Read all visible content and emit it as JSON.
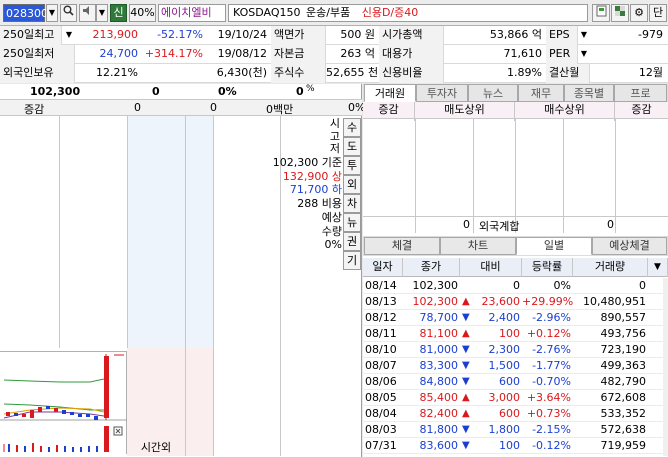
{
  "toolbar": {
    "code": "028300",
    "sin_label": "신",
    "pct_label": "40%",
    "stock_name": "에이치엘비",
    "market": "KOSDAQ150",
    "sector": "운송/부품",
    "credit": "신용D/증40"
  },
  "summary": {
    "rows": [
      {
        "l1": "250일최고",
        "v1": "213,900",
        "p1": "-52.17%",
        "d1": "19/10/24",
        "l2": "액면가",
        "v2": "500 원",
        "l3": "시가총액",
        "v3": "53,866 억",
        "l4": "EPS",
        "v4": "-979"
      },
      {
        "l1": "250일최저",
        "v1": "24,700",
        "p1": "+314.17%",
        "d1": "19/08/12",
        "l2": "자본금",
        "v2": "263 억",
        "l3": "대용가",
        "v3": "71,610",
        "l4": "PER",
        "v4": ""
      },
      {
        "l1": "외국인보유",
        "v1": "12.21%",
        "p1": "6,430(천)",
        "d1": "",
        "l2": "주식수",
        "v2": "52,655 천",
        "l3": "신용비율",
        "v3": "1.89%",
        "l4": "결산월",
        "v4": "12월"
      }
    ]
  },
  "left": {
    "price": "102,300",
    "change": "0",
    "pct": "0%",
    "vol": "0",
    "vol_unit": "%",
    "header_label": "증감",
    "header_vals": [
      "0",
      "0"
    ],
    "header_money": "0백만",
    "header_pct": "0%",
    "labels": [
      {
        "label": "시",
        "value": ""
      },
      {
        "label": "고",
        "value": ""
      },
      {
        "label": "저",
        "value": ""
      },
      {
        "label": "기준",
        "value": "102,300"
      },
      {
        "label": "상",
        "value": "132,900"
      },
      {
        "label": "하",
        "value": "71,700"
      },
      {
        "label": "비용",
        "value": "288"
      },
      {
        "label": "예상",
        "value": ""
      },
      {
        "label": "수량",
        "value": ""
      },
      {
        "label": "",
        "value": "0%"
      }
    ],
    "side_buttons": [
      "수",
      "도",
      "투",
      "외",
      "차",
      "뉴",
      "권",
      "기"
    ],
    "bottom_label": "시간외"
  },
  "right": {
    "tabs_top": [
      "거래원",
      "투자자",
      "뉴스",
      "재무",
      "종목별",
      "프로"
    ],
    "trader_headers": [
      "증감",
      "매도상위",
      "매수상위",
      "증감"
    ],
    "foreign_label": "외국계합",
    "foreign_vals": [
      "0",
      "0"
    ],
    "tabs_mid": [
      "체결",
      "차트",
      "일별",
      "예상체결"
    ],
    "table_headers": [
      "일자",
      "종가",
      "대비",
      "등락률",
      "거래량"
    ],
    "rows": [
      {
        "date": "08/14",
        "close": "102,300",
        "dir": "",
        "diff": "0",
        "rate": "0%",
        "vol": "0"
      },
      {
        "date": "08/13",
        "close": "102,300",
        "dir": "up",
        "diff": "23,600",
        "rate": "+29.99%",
        "vol": "10,480,951"
      },
      {
        "date": "08/12",
        "close": "78,700",
        "dir": "dn",
        "diff": "2,400",
        "rate": "-2.96%",
        "vol": "890,557"
      },
      {
        "date": "08/11",
        "close": "81,100",
        "dir": "up",
        "diff": "100",
        "rate": "+0.12%",
        "vol": "493,756"
      },
      {
        "date": "08/10",
        "close": "81,000",
        "dir": "dn",
        "diff": "2,300",
        "rate": "-2.76%",
        "vol": "723,190"
      },
      {
        "date": "08/07",
        "close": "83,300",
        "dir": "dn",
        "diff": "1,500",
        "rate": "-1.77%",
        "vol": "499,363"
      },
      {
        "date": "08/06",
        "close": "84,800",
        "dir": "dn",
        "diff": "600",
        "rate": "-0.70%",
        "vol": "482,790"
      },
      {
        "date": "08/05",
        "close": "85,400",
        "dir": "up",
        "diff": "3,000",
        "rate": "+3.64%",
        "vol": "672,608"
      },
      {
        "date": "08/04",
        "close": "82,400",
        "dir": "up",
        "diff": "600",
        "rate": "+0.73%",
        "vol": "533,352"
      },
      {
        "date": "08/03",
        "close": "81,800",
        "dir": "dn",
        "diff": "1,800",
        "rate": "-2.15%",
        "vol": "572,638"
      },
      {
        "date": "07/31",
        "close": "83,600",
        "dir": "dn",
        "diff": "100",
        "rate": "-0.12%",
        "vol": "719,959"
      }
    ]
  },
  "colors": {
    "up": "#d9191d",
    "down": "#1b3fd1",
    "accent": "#2b58d6"
  }
}
